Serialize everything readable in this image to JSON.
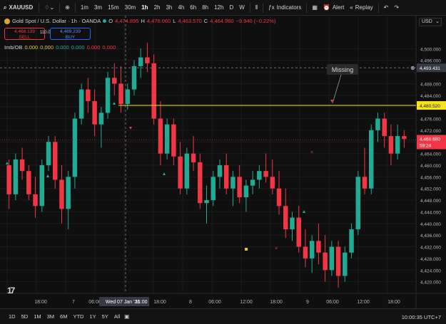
{
  "toolbar": {
    "symbol": "XAUUSD",
    "intervals": [
      "1m",
      "3m",
      "15m",
      "30m",
      "1h",
      "2h",
      "3h",
      "4h",
      "6h",
      "8h",
      "12h",
      "D",
      "W"
    ],
    "active_interval": "1h",
    "indicators_label": "Indicators",
    "alert_label": "Alert",
    "replay_label": "Replay"
  },
  "legend": {
    "title": "Gold Spot / U.S. Dollar · 1h · OANDA",
    "o_label": "O",
    "o_val": "4,474.895",
    "h_label": "H",
    "h_val": "4,476.060",
    "l_label": "L",
    "l_val": "4,463.570",
    "c_label": "C",
    "c_val": "4,464.960",
    "change": "−9.940 (−0.22%)"
  },
  "trade": {
    "sell_price": "4,468.139",
    "sell_label": "SELL",
    "spread": "110.0",
    "buy_price": "4,469.239",
    "buy_label": "BUY"
  },
  "indicator": {
    "name": "Imb/OB",
    "values": [
      "0.000",
      "0.000",
      "0.000",
      "0.000",
      "0.000",
      "0.000"
    ],
    "value_colors": [
      "#e0c52c",
      "#e0c52c",
      "#22ab94",
      "#22ab94",
      "#f23645",
      "#f23645"
    ]
  },
  "price_axis": {
    "currency": "USD",
    "ticks": [
      "4,500.000",
      "4,496.000",
      "4,488.000",
      "4,484.000",
      "4,476.000",
      "4,472.000",
      "4,464.000",
      "4,460.000",
      "4,456.000",
      "4,452.000",
      "4,448.000",
      "4,444.000",
      "4,440.000",
      "4,436.000",
      "4,432.000",
      "4,428.000",
      "4,424.000",
      "4,420.000"
    ],
    "crosshair_label": "4,493.431",
    "line_label": "4,480.520",
    "current_price": "4,468.680",
    "countdown": "59:24"
  },
  "time_axis": {
    "ticks": [
      "18:00",
      "7",
      "06:00",
      "Wed 07 Jan '26",
      "11:00",
      "18:00",
      "8",
      "06:00",
      "12:00",
      "18:00",
      "9",
      "06:00",
      "12:00",
      "18:00"
    ]
  },
  "annotation": {
    "text": "Missing"
  },
  "bottom_bar": {
    "ranges": [
      "1D",
      "5D",
      "1M",
      "3M",
      "6M",
      "YTD",
      "1Y",
      "5Y",
      "All"
    ],
    "clock": "10:00:35 UTC+7"
  },
  "colors": {
    "up": "#22ab94",
    "down": "#f23645",
    "hline": "#f5e31a",
    "bg": "#0f0f0f"
  },
  "chart_data": {
    "type": "candlestick",
    "price_range": [
      4416,
      4504
    ],
    "candles": [
      [
        4460,
        4462,
        4445,
        4450
      ],
      [
        4450,
        4464,
        4448,
        4462
      ],
      [
        4462,
        4466,
        4455,
        4458
      ],
      [
        4458,
        4460,
        4448,
        4450
      ],
      [
        4450,
        4456,
        4442,
        4446
      ],
      [
        4446,
        4462,
        4444,
        4460
      ],
      [
        4460,
        4470,
        4458,
        4468
      ],
      [
        4468,
        4470,
        4452,
        4455
      ],
      [
        4455,
        4460,
        4440,
        4445
      ],
      [
        4445,
        4458,
        4438,
        4456
      ],
      [
        4456,
        4478,
        4452,
        4476
      ],
      [
        4476,
        4488,
        4474,
        4486
      ],
      [
        4486,
        4490,
        4478,
        4482
      ],
      [
        4482,
        4486,
        4470,
        4474
      ],
      [
        4474,
        4480,
        4466,
        4478
      ],
      [
        4478,
        4492,
        4476,
        4490
      ],
      [
        4490,
        4495,
        4484,
        4488
      ],
      [
        4488,
        4494,
        4478,
        4481
      ],
      [
        4481,
        4488,
        4479,
        4486
      ],
      [
        4486,
        4496,
        4484,
        4494
      ],
      [
        4494,
        4500,
        4490,
        4497
      ],
      [
        4497,
        4502,
        4492,
        4495
      ],
      [
        4495,
        4498,
        4474,
        4476
      ],
      [
        4476,
        4482,
        4460,
        4464
      ],
      [
        4464,
        4476,
        4462,
        4474
      ],
      [
        4474,
        4476,
        4460,
        4463
      ],
      [
        4463,
        4468,
        4450,
        4452
      ],
      [
        4452,
        4466,
        4450,
        4464
      ],
      [
        4464,
        4470,
        4458,
        4461
      ],
      [
        4461,
        4464,
        4445,
        4447
      ],
      [
        4447,
        4453,
        4440,
        4448
      ],
      [
        4448,
        4458,
        4446,
        4456
      ],
      [
        4456,
        4462,
        4452,
        4460
      ],
      [
        4460,
        4464,
        4450,
        4452
      ],
      [
        4452,
        4458,
        4446,
        4456
      ],
      [
        4456,
        4460,
        4447,
        4449
      ],
      [
        4449,
        4455,
        4444,
        4453
      ],
      [
        4453,
        4458,
        4450,
        4455
      ],
      [
        4455,
        4460,
        4452,
        4458
      ],
      [
        4458,
        4464,
        4454,
        4456
      ],
      [
        4456,
        4462,
        4450,
        4452
      ],
      [
        4452,
        4458,
        4443,
        4446
      ],
      [
        4446,
        4452,
        4435,
        4438
      ],
      [
        4438,
        4444,
        4434,
        4442
      ],
      [
        4442,
        4446,
        4430,
        4432
      ],
      [
        4432,
        4438,
        4425,
        4428
      ],
      [
        4428,
        4436,
        4423,
        4434
      ],
      [
        4434,
        4440,
        4426,
        4430
      ],
      [
        4430,
        4436,
        4420,
        4424
      ],
      [
        4424,
        4434,
        4422,
        4432
      ],
      [
        4432,
        4434,
        4418,
        4422
      ],
      [
        4422,
        4432,
        4420,
        4430
      ],
      [
        4430,
        4440,
        4428,
        4438
      ],
      [
        4438,
        4458,
        4436,
        4456
      ],
      [
        4456,
        4466,
        4450,
        4452
      ],
      [
        4452,
        4474,
        4450,
        4472
      ],
      [
        4472,
        4478,
        4468,
        4476
      ],
      [
        4476,
        4478,
        4466,
        4470
      ],
      [
        4470,
        4474,
        4460,
        4464
      ],
      [
        4464,
        4474,
        4462,
        4470
      ],
      [
        4470,
        4472,
        4466,
        4469
      ]
    ],
    "hline_price": 4480.52
  }
}
